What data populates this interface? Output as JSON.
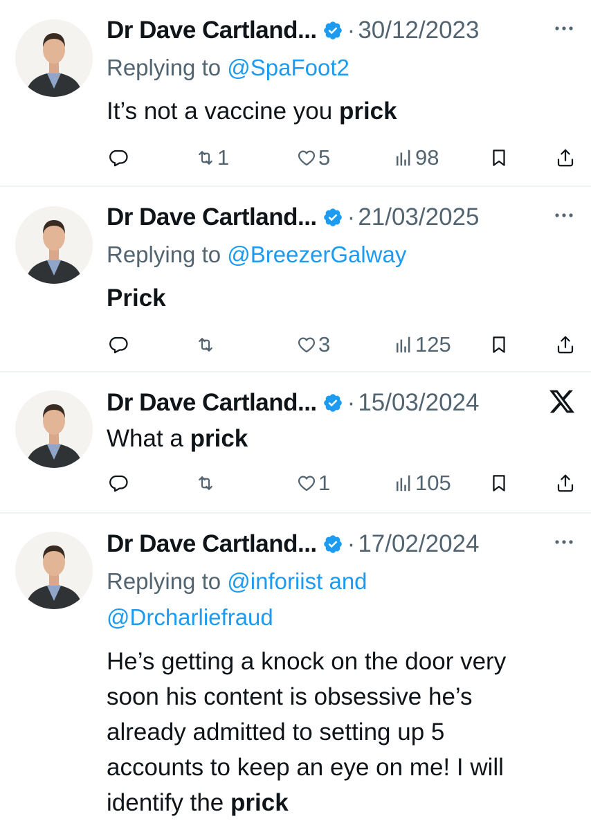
{
  "tweets": [
    {
      "author": "Dr Dave Cartland...",
      "date": "30/12/2023",
      "replying_label": "Replying to ",
      "reply_to": "@SpaFoot2",
      "text_plain": "It’s not a vaccine you ",
      "text_bold": "prick",
      "retweets": "1",
      "likes": "5",
      "views": "98",
      "corner_icon": "more-icon"
    },
    {
      "author": "Dr Dave Cartland...",
      "date": "21/03/2025",
      "replying_label": "Replying to ",
      "reply_to": "@BreezerGalway",
      "text_plain": "",
      "text_bold": "Prick",
      "retweets": "",
      "likes": "3",
      "views": "125",
      "corner_icon": "more-icon"
    },
    {
      "author": "Dr Dave Cartland...",
      "date": "15/03/2024",
      "text_plain": "What a ",
      "text_bold": "prick",
      "retweets": "",
      "likes": "1",
      "views": "105",
      "corner_icon": "x-logo-icon"
    },
    {
      "author": "Dr Dave Cartland...",
      "date": "17/02/2024",
      "replying_label": "Replying to ",
      "reply_to": "@inforiist and",
      "reply_to_2": "@Drcharliefraud",
      "text_line1": "He’s getting a knock on the door very",
      "text_line2": "soon his content is obsessive he’s",
      "text_line3": "already admitted to setting up 5",
      "text_line4": "accounts to keep an eye on me! I will",
      "text_line5_plain": "identify the ",
      "text_bold": "prick",
      "corner_icon": "more-icon"
    }
  ],
  "colors": {
    "link": "#1d9bf0",
    "muted": "#536471",
    "text": "#0f1419",
    "divider": "#eff3f4"
  }
}
